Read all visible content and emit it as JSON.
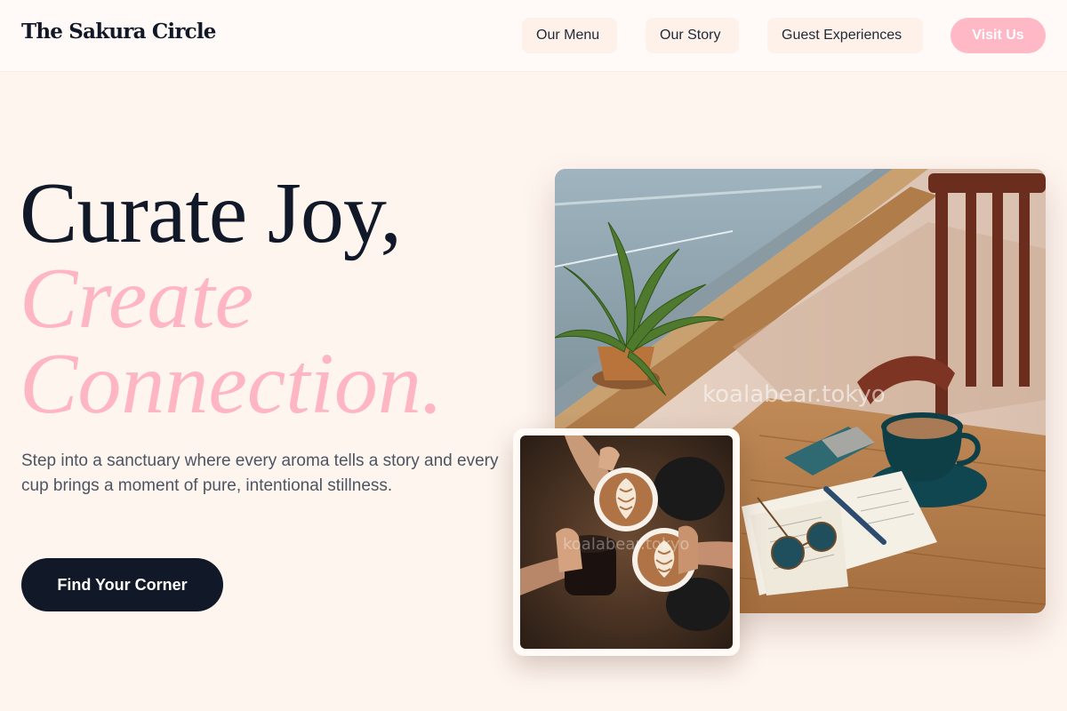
{
  "brand": {
    "name": "The Sakura Circle"
  },
  "nav": {
    "links": [
      {
        "label": "Our Menu"
      },
      {
        "label": "Our Story"
      },
      {
        "label": "Guest Experiences"
      }
    ],
    "cta_label": "Visit Us"
  },
  "hero": {
    "headline_line1": "Curate Joy,",
    "headline_line2": "Create",
    "headline_line3": "Connection.",
    "lead": "Step into a sanctuary where every aroma tells a story and every cup brings a moment of pure, intentional stillness.",
    "cta_label": "Find Your Corner"
  },
  "images": {
    "main_watermark": "koalabear.tokyo",
    "small_watermark": "koalabear.tokyo"
  },
  "colors": {
    "page_background": "#fff5ef",
    "nav_background": "#fffaf7",
    "accent_pink": "#ffb6c3",
    "dark_navy": "#111827",
    "body_text": "#4b5563"
  }
}
